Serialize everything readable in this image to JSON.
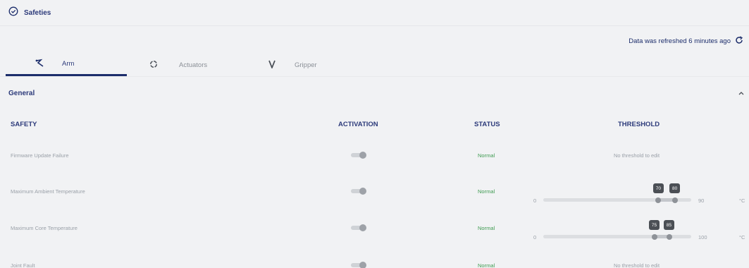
{
  "header": {
    "title": "Safeties",
    "icon": "shield-check-icon"
  },
  "refresh": {
    "text": "Data was refreshed 6 minutes ago",
    "icon": "refresh-icon"
  },
  "tabs": [
    {
      "label": "Arm",
      "icon": "arm-icon",
      "active": true
    },
    {
      "label": "Actuators",
      "icon": "actuator-ring-icon",
      "active": false
    },
    {
      "label": "Gripper",
      "icon": "gripper-icon",
      "active": false
    }
  ],
  "section": {
    "title": "General",
    "icon": "chevron-up-icon"
  },
  "table": {
    "columns": [
      "SAFETY",
      "ACTIVATION",
      "STATUS",
      "THRESHOLD"
    ],
    "rows": [
      {
        "name": "Firmware Update Failure",
        "activation": true,
        "status": "Normal",
        "threshold_text": "No threshold to edit"
      },
      {
        "name": "Maximum Ambient Temperature",
        "activation": true,
        "status": "Normal",
        "slider": {
          "min": "0",
          "max": "90",
          "unit": "°C",
          "low": "70",
          "high": "80",
          "min_value": 0,
          "max_value": 90,
          "low_value": 70,
          "high_value": 80
        }
      },
      {
        "name": "Maximum Core Temperature",
        "activation": true,
        "status": "Normal",
        "slider": {
          "min": "0",
          "max": "100",
          "unit": "°C",
          "low": "75",
          "high": "85",
          "min_value": 0,
          "max_value": 100,
          "low_value": 75,
          "high_value": 85
        }
      },
      {
        "name": "Joint Fault",
        "activation": true,
        "status": "Normal",
        "threshold_text": "No threshold to edit"
      }
    ]
  },
  "colors": {
    "accent": "#1c2d6b",
    "status_normal": "#3f9b51",
    "background": "#f1f2f4"
  }
}
